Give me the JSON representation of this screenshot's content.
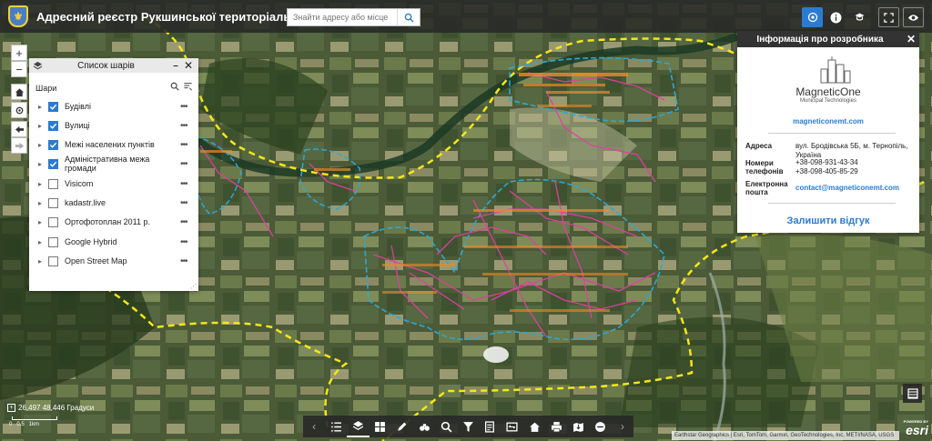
{
  "header": {
    "title": "Адресний реєстр Рукшинської територіальної громади",
    "logo_icon": "coat-of-arms-icon",
    "search_placeholder": "Знайти адресу або місце"
  },
  "layer_panel": {
    "title": "Список шарів",
    "section": "Шари",
    "layers": [
      {
        "label": "Будівлі",
        "checked": true
      },
      {
        "label": "Вулиці",
        "checked": true
      },
      {
        "label": "Межі населених пунктів",
        "checked": true
      },
      {
        "label": "Адміністративна межа громади",
        "checked": true
      },
      {
        "label": "Visicom",
        "checked": false
      },
      {
        "label": "kadastr.live",
        "checked": false
      },
      {
        "label": "Ортофотоплан 2011 р.",
        "checked": false
      },
      {
        "label": "Google Hybrid",
        "checked": false
      },
      {
        "label": "Open Street Map",
        "checked": false
      }
    ]
  },
  "info_panel": {
    "title": "Інформація про розробника",
    "brand_name": "MagneticOne",
    "brand_sub": "Municipal Technologies",
    "website": "magneticonemt.com",
    "address_label": "Адреса",
    "address_value": "вул. Бродівська 5Б, м. Тернопіль, Україна",
    "phones_label_1": "Номери",
    "phones_label_2": "телефонів",
    "phone_1": "+38-098-931-43-34",
    "phone_2": "+38-098-405-85-29",
    "email_label_1": "Електронна",
    "email_label_2": "пошта",
    "email_value": "contact@magneticonemt.com",
    "feedback": "Залишити відгук"
  },
  "status": {
    "coords": "26,497 48,446 Градуси",
    "scale": "0   0,5   1km",
    "attribution": "Earthstar Geographics | Esri, TomTom, Garmin, GeoTechnologies, Inc, METI/NASA, USGS",
    "powered_by": "POWERED BY",
    "esri": "esri"
  },
  "colors": {
    "header_bg": "#282828",
    "accent": "#2b7bd2",
    "boundary_yellow": "#f5e619",
    "settlement_blue": "#2aa8d8",
    "streets_magenta": "#e040a0",
    "buildings_orange": "#f08a24"
  }
}
